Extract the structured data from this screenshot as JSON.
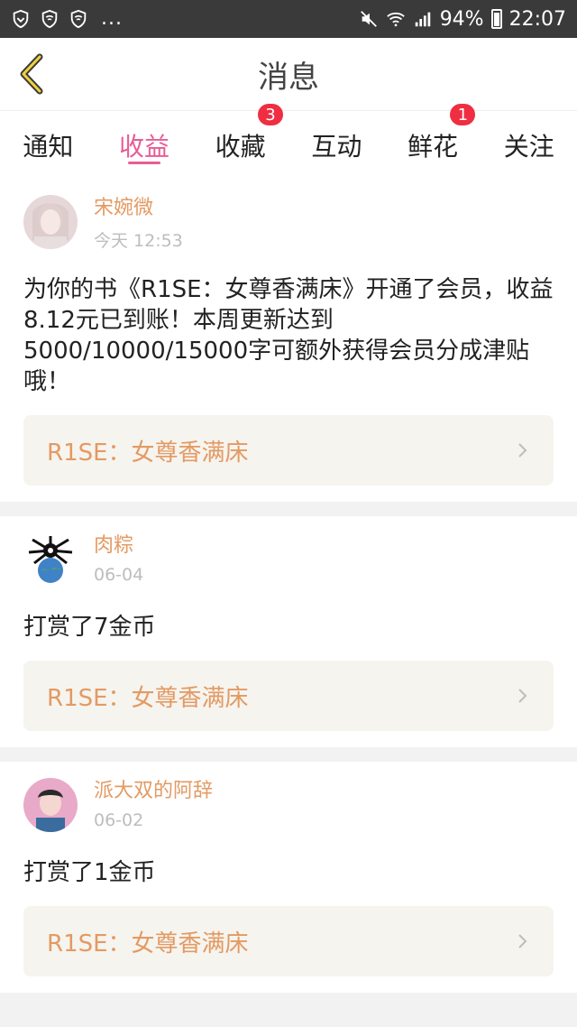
{
  "status_bar": {
    "battery": "94%",
    "time": "22:07",
    "dots": "..."
  },
  "header": {
    "title": "消息"
  },
  "tabs": [
    {
      "label": "通知",
      "badge": ""
    },
    {
      "label": "收益",
      "badge": "",
      "active": true
    },
    {
      "label": "收藏",
      "badge": "3"
    },
    {
      "label": "互动",
      "badge": ""
    },
    {
      "label": "鲜花",
      "badge": "1"
    },
    {
      "label": "关注",
      "badge": ""
    }
  ],
  "messages": [
    {
      "user": "宋婉微",
      "time": "今天 12:53",
      "text": "为你的书《R1SE：女尊香满床》开通了会员，收益8.12元已到账！本周更新达到5000/10000/15000字可额外获得会员分成津贴哦！",
      "book": "R1SE：女尊香满床"
    },
    {
      "user": "肉粽",
      "time": "06-04",
      "text": "打赏了7金币",
      "book": "R1SE：女尊香满床"
    },
    {
      "user": "派大双的阿辞",
      "time": "06-02",
      "text": "打赏了1金币",
      "book": "R1SE：女尊香满床"
    }
  ],
  "colors": {
    "accent": "#e85c95",
    "badge": "#ef2e42",
    "username": "#e39a63",
    "book_link": "#e39a63",
    "status_bar": "#3a3a3a"
  }
}
